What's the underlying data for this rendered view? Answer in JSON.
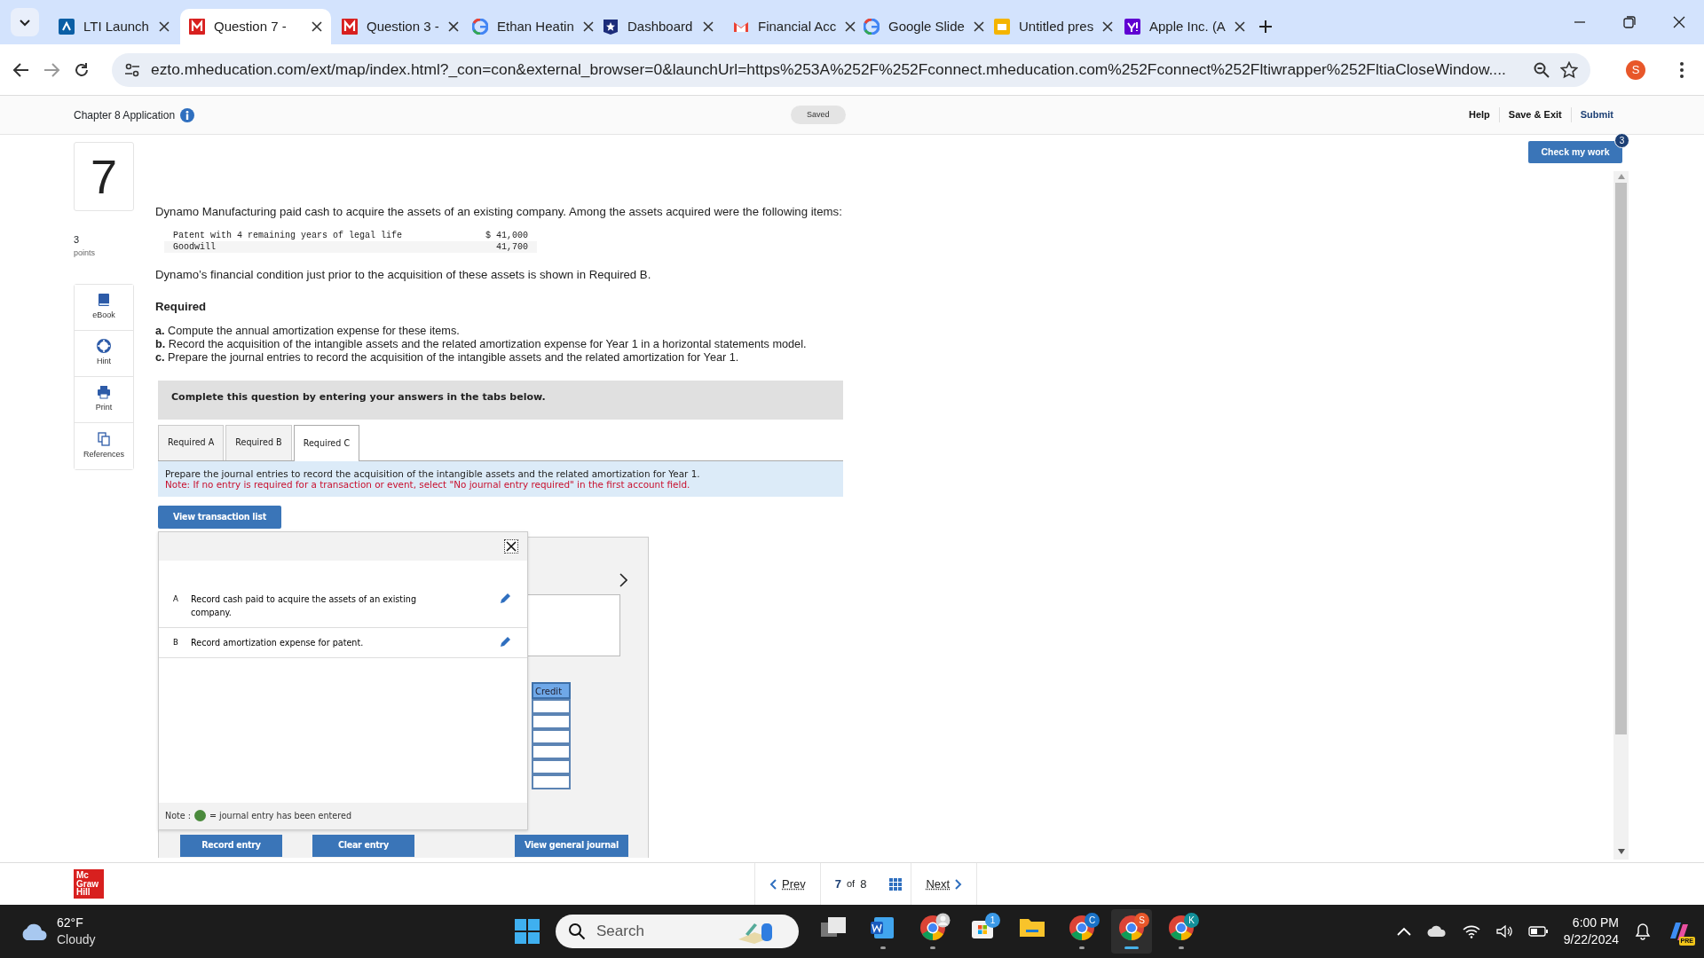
{
  "browser": {
    "tabs": [
      {
        "kind": "lti",
        "title": "LTI Launch",
        "selected": false
      },
      {
        "kind": "mh",
        "title": "Question 7 -",
        "selected": true
      },
      {
        "kind": "mh",
        "title": "Question 3 -",
        "selected": false
      },
      {
        "kind": "google",
        "title": "Ethan Heatin",
        "selected": false
      },
      {
        "kind": "dashboard",
        "title": "Dashboard",
        "selected": false
      },
      {
        "kind": "gmail",
        "title": "Financial Acc",
        "selected": false
      },
      {
        "kind": "google",
        "title": "Google Slide",
        "selected": false
      },
      {
        "kind": "slides",
        "title": "Untitled pres",
        "selected": false
      },
      {
        "kind": "yahoo",
        "title": "Apple Inc. (A",
        "selected": false
      }
    ],
    "url": "ezto.mheducation.com/ext/map/index.html?_con=con&external_browser=0&launchUrl=https%253A%252F%252Fconnect.mheducation.com%252Fconnect%252Fltiwrapper%252FltiaCloseWindow....",
    "profile": "S"
  },
  "header": {
    "title": "Chapter 8 Application",
    "status": "Saved",
    "links": [
      "Help",
      "Save & Exit",
      "Submit"
    ]
  },
  "check_button": {
    "label": "Check my work",
    "badge": "3"
  },
  "question": {
    "number": "7",
    "points": "3",
    "points_label": "points"
  },
  "tools": [
    {
      "kind": "ebook",
      "label": "eBook"
    },
    {
      "kind": "hint",
      "label": "Hint"
    },
    {
      "kind": "print",
      "label": "Print"
    },
    {
      "kind": "references",
      "label": "References"
    }
  ],
  "intro": "Dynamo Manufacturing paid cash to acquire the assets of an existing company. Among the assets acquired were the following items:",
  "assets": [
    {
      "name": "Patent with 4 remaining years of legal life",
      "amount": "$ 41,000"
    },
    {
      "name": "Goodwill",
      "amount": "41,700"
    }
  ],
  "condition": "Dynamo’s financial condition just prior to the acquisition of these assets is shown in Required B.",
  "required_heading": "Required",
  "requirements": [
    "**a.** Compute the annual amortization expense for these items.",
    "**b.** Record the acquisition of the intangible assets and the related amortization expense for Year 1 in a horizontal statements model.",
    "**c.** Prepare the journal entries to record the acquisition of the intangible assets and the related amortization for Year 1."
  ],
  "banner": "Complete this question by entering your answers in the tabs below.",
  "answer_tabs": [
    {
      "label": "Required A",
      "selected": false
    },
    {
      "label": "Required B",
      "selected": false
    },
    {
      "label": "Required C",
      "selected": true
    }
  ],
  "tab_instruction": "Prepare the journal entries to record the acquisition of the intangible assets and the related amortization for Year 1.",
  "tab_note": "Note: If no entry is required for a transaction or event, select \"No journal entry required\" in the first account field.",
  "transaction_button": "View transaction list",
  "transactions": [
    {
      "letter": "A",
      "text": "Record cash paid to acquire the assets of an existing company."
    },
    {
      "letter": "B",
      "text": "Record amortization expense for patent."
    }
  ],
  "legend": {
    "prefix": "Note :",
    "text": "= journal entry has been entered"
  },
  "journal": {
    "column": "Credit"
  },
  "journal_buttons": [
    "Record entry",
    "Clear entry",
    "View general journal"
  ],
  "pager": {
    "prev": "Prev",
    "current": "7",
    "of": "of",
    "total": "8",
    "next": "Next"
  },
  "logo": [
    "Mc",
    "Graw",
    "Hill"
  ],
  "taskbar": {
    "temperature": "62°F",
    "weather": "Cloudy",
    "search": {
      "placeholder": "Search"
    },
    "apps": [
      {
        "kind": "taskview",
        "open": false,
        "selected": false
      },
      {
        "kind": "word",
        "open": true,
        "selected": false
      },
      {
        "kind": "chrome",
        "open": true,
        "selected": false,
        "avatar": true
      },
      {
        "kind": "store",
        "open": false,
        "selected": false,
        "badge": "1",
        "color": "#3b9ae8"
      },
      {
        "kind": "folder",
        "open": false,
        "selected": false
      },
      {
        "kind": "chrome",
        "open": true,
        "selected": false,
        "badge": "C",
        "color": "#1a73c8"
      },
      {
        "kind": "chrome",
        "open": true,
        "selected": true,
        "badge": "S",
        "color": "#e8572a"
      },
      {
        "kind": "chrome",
        "open": true,
        "selected": false,
        "badge": "K",
        "color": "#12909a"
      }
    ],
    "copilot_label": "PRE",
    "time": "6:00 PM",
    "date": "9/22/2024"
  }
}
